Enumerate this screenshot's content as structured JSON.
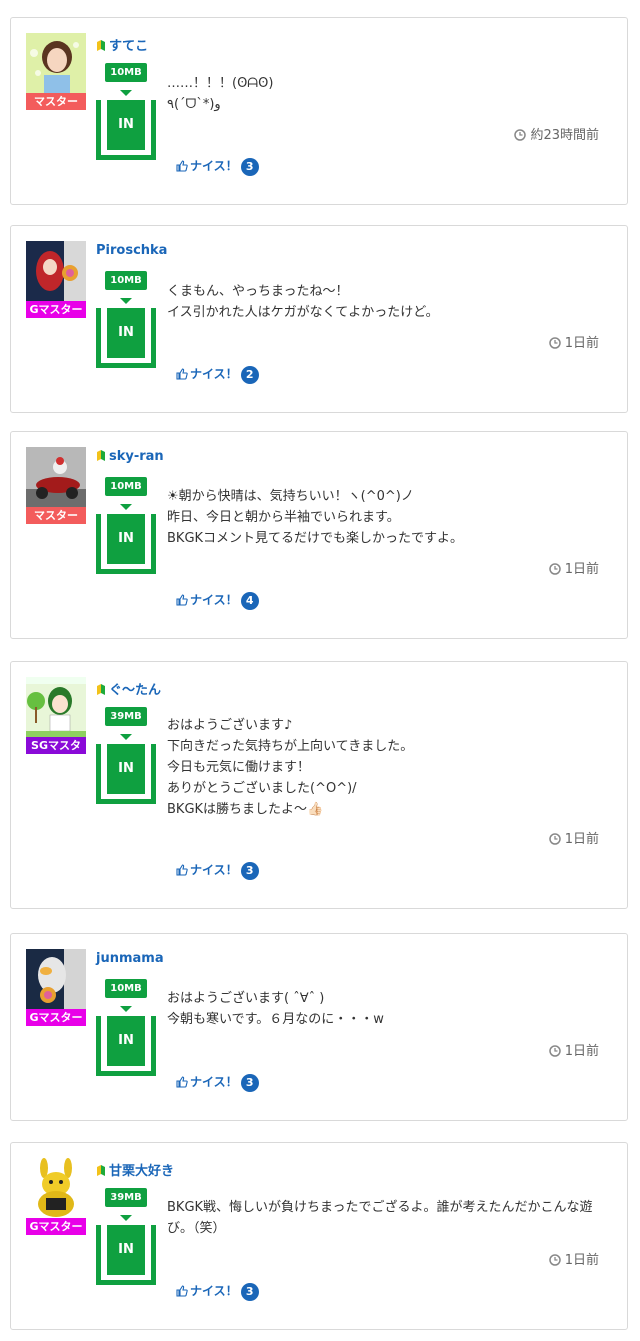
{
  "icons": {
    "leaf": "beginner-leaf-icon",
    "clock": "clock-icon",
    "thumb": "thumbs-up-icon"
  },
  "colors": {
    "green": "#0fa040",
    "blue": "#1a66b8",
    "master": "#f35c5c",
    "gmaster": "#e800e8",
    "sgmaster": "#8a0ad8"
  },
  "posts": [
    {
      "user": "すてこ",
      "beginner": true,
      "rank": "マスター",
      "rank_color": "#f35c5c",
      "data_mb": "10MB",
      "status": "IN",
      "message": "……！！！(ʘᗩʘ)\n٩(ˊᗜˋ*)و",
      "time": "約23時間前",
      "nice_label": "ナイス！",
      "nice_count": "3"
    },
    {
      "user": "Piroschka",
      "beginner": false,
      "rank": "Gマスター",
      "rank_color": "#e800e8",
      "data_mb": "10MB",
      "status": "IN",
      "message": "くまもん、やっちまったね〜！\nイス引かれた人はケガがなくてよかったけど。",
      "time": "1日前",
      "nice_label": "ナイス！",
      "nice_count": "2"
    },
    {
      "user": "sky-ran",
      "beginner": true,
      "rank": "マスター",
      "rank_color": "#f35c5c",
      "data_mb": "10MB",
      "status": "IN",
      "message": "☀朝から快晴は、気持ちいい！ヽ(^0^)ノ\n昨日、今日と朝から半袖でいられます。\nBKGKコメント見てるだけでも楽しかったですよ。",
      "time": "1日前",
      "nice_label": "ナイス！",
      "nice_count": "4"
    },
    {
      "user": "ぐ〜たん",
      "beginner": true,
      "rank": "SGマスタ",
      "rank_color": "#8a0ad8",
      "data_mb": "39MB",
      "status": "IN",
      "message": "おはようございます♪\n下向きだった気持ちが上向いてきました。\n今日も元気に働けます！\nありがとうございました(^O^)/\nBKGKは勝ちましたよ〜👍🏻",
      "time": "1日前",
      "nice_label": "ナイス！",
      "nice_count": "3"
    },
    {
      "user": "junmama",
      "beginner": false,
      "rank": "Gマスター",
      "rank_color": "#e800e8",
      "data_mb": "10MB",
      "status": "IN",
      "message": "おはようございます( ˆ∀ˆ )\n今朝も寒いです。６月なのに・・・w",
      "time": "1日前",
      "nice_label": "ナイス！",
      "nice_count": "3"
    },
    {
      "user": "甘栗大好き",
      "beginner": true,
      "rank": "Gマスター",
      "rank_color": "#e800e8",
      "data_mb": "39MB",
      "status": "IN",
      "message": "BKGK戦、悔しいが負けちまったでござるよ。誰が考えたんだかこんな遊び。（笑）",
      "time": "1日前",
      "nice_label": "ナイス！",
      "nice_count": "3"
    }
  ]
}
